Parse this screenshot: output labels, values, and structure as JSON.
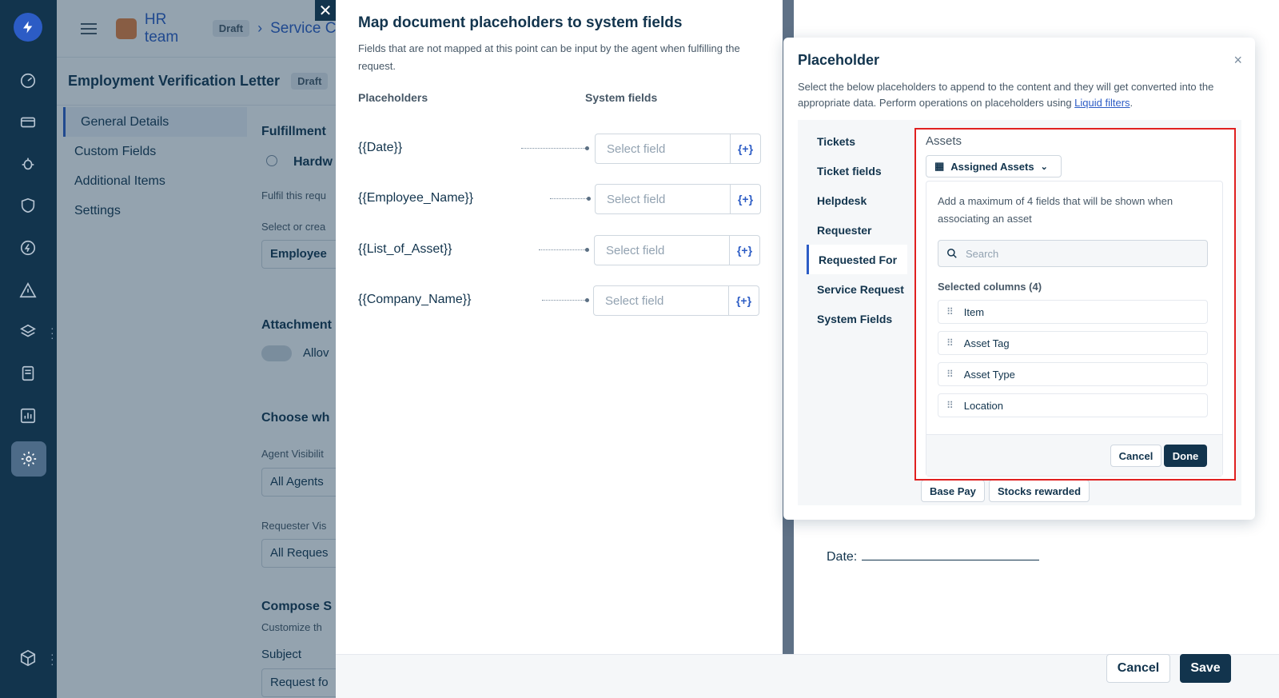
{
  "background_page": {
    "team_name": "HR team",
    "draft_badge": "Draft",
    "breadcrumb_next": "Service Ca",
    "page_title": "Employment Verification Letter",
    "title_badge": "Draft",
    "sidebar": [
      "General Details",
      "Custom Fields",
      "Additional Items",
      "Settings"
    ],
    "content": {
      "fulfillment": "Fulfillment",
      "hardware": "Hardw",
      "fulfil_text": "Fulfil this requ",
      "select_or_create": "Select or crea",
      "employee_field": "Employee",
      "attachments": "Attachment",
      "allow": "Allov",
      "choose_who": "Choose wh",
      "agent_visibility": "Agent Visibilit",
      "all_agents": "All Agents",
      "requester_visibility": "Requester Vis",
      "all_requesters": "All Reques",
      "compose": "Compose S",
      "customize": "Customize th",
      "subject": "Subject",
      "request_for": "Request fo"
    }
  },
  "mapper": {
    "title": "Map document placeholders to system fields",
    "description": "Fields that are not mapped at this point can be input by the agent when fulfilling the request.",
    "col_placeholders": "Placeholders",
    "col_system_fields": "System fields",
    "rows": [
      {
        "placeholder": "{{Date}}",
        "select": "Select field",
        "insert": "{+}"
      },
      {
        "placeholder": "{{Employee_Name}}",
        "select": "Select field",
        "insert": "{+}"
      },
      {
        "placeholder": "{{List_of_Asset}}",
        "select": "Select field",
        "insert": "{+}"
      },
      {
        "placeholder": "{{Company_Name}}",
        "select": "Select field",
        "insert": "{+}"
      }
    ]
  },
  "placeholder_popover": {
    "title": "Placeholder",
    "close": "×",
    "description_prefix": "Select the below placeholders to append to the content and they will get converted into the appropriate data. Perform operations on placeholders using ",
    "liquid_link": "Liquid filters",
    "description_suffix": ".",
    "tabs": [
      "Tickets",
      "Ticket fields",
      "Helpdesk",
      "Requester",
      "Requested For",
      "Service Request",
      "System Fields"
    ],
    "active_tab": "Requested For",
    "assets": {
      "title": "Assets",
      "dropdown": "Assigned Assets",
      "help": "Add a maximum of 4 fields that will be shown when associating an asset",
      "search_placeholder": "Search",
      "selected_label": "Selected columns (4)",
      "columns": [
        "Item",
        "Asset Tag",
        "Asset Type",
        "Location"
      ],
      "cancel": "Cancel",
      "done": "Done"
    },
    "chips_below": [
      "Base Pay",
      "Stocks rewarded"
    ]
  },
  "document": {
    "date_label": "Date:"
  },
  "footer": {
    "cancel": "Cancel",
    "save": "Save"
  }
}
